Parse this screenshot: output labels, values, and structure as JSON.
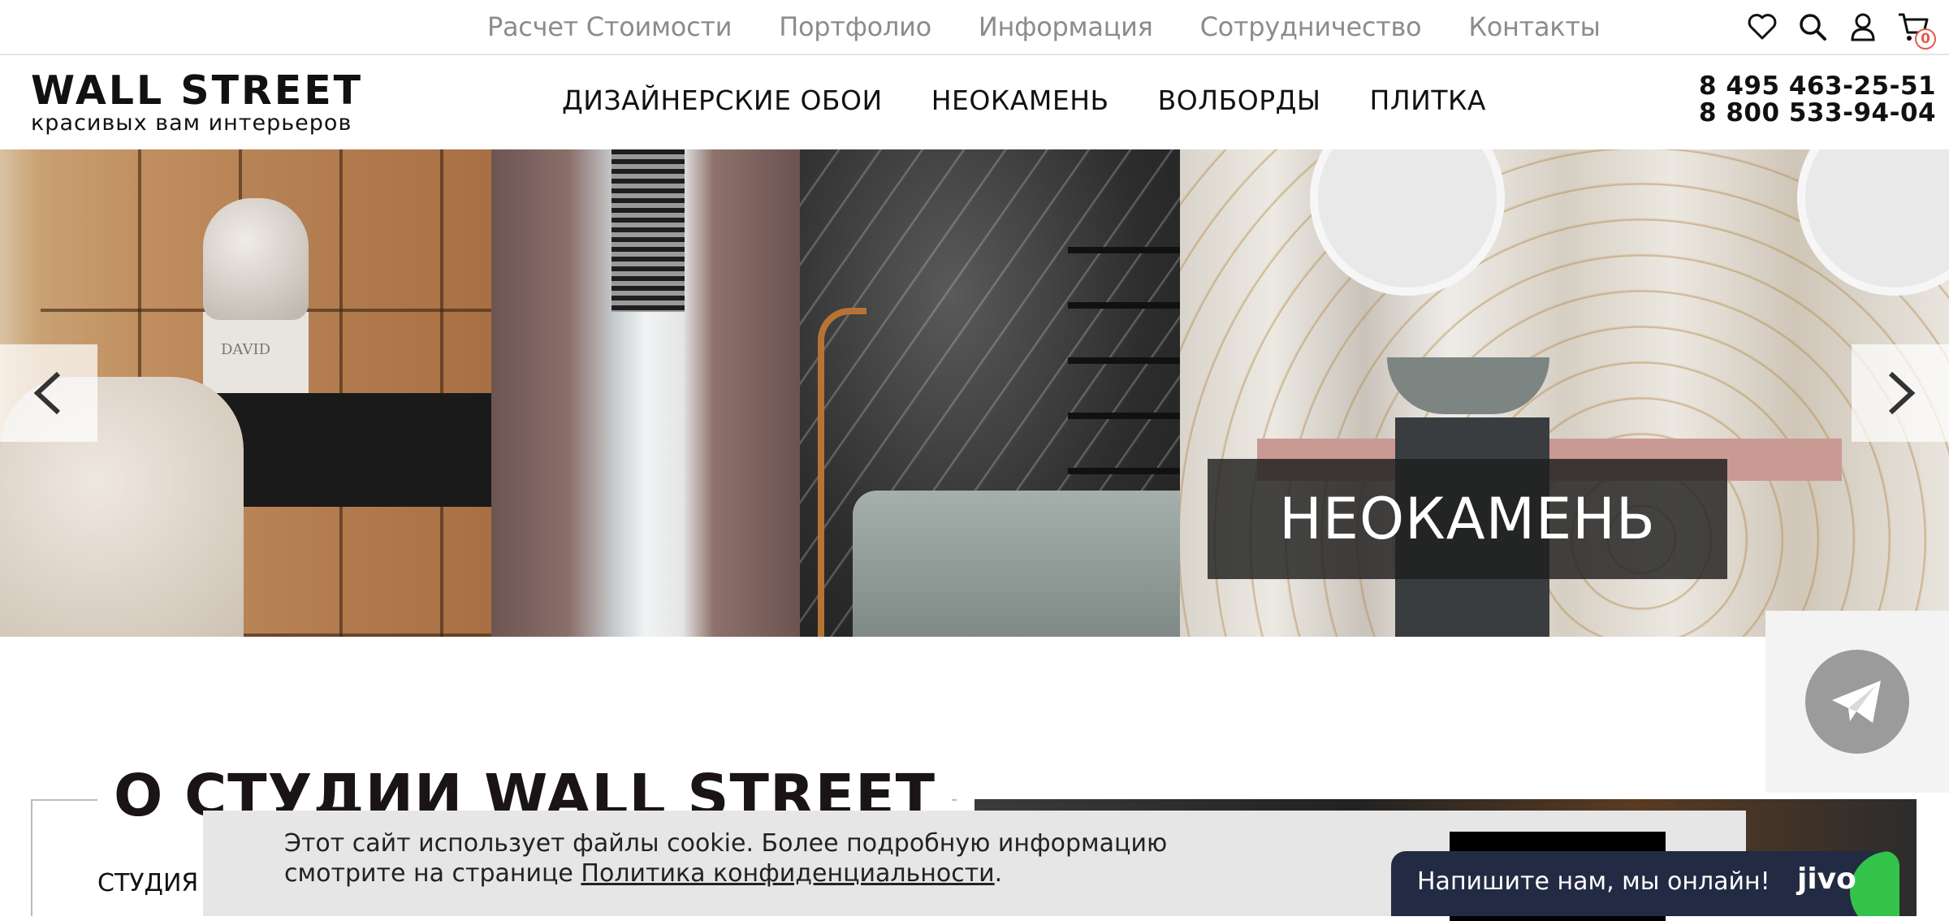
{
  "top_nav": [
    "Расчет Стоимости",
    "Портфолио",
    "Информация",
    "Сотрудничество",
    "Контакты"
  ],
  "cart_count": "0",
  "logo": {
    "title": "WALL STREET",
    "subtitle": "красивых вам интерьеров"
  },
  "main_nav": [
    "ДИЗАЙНЕРСКИЕ ОБОИ",
    "НЕОКАМЕНЬ",
    "ВОЛБОРДЫ",
    "ПЛИТКА"
  ],
  "phones": [
    "8 495 463-25-51",
    "8 800 533-94-04"
  ],
  "slider": {
    "caption": "НЕОКАМЕНЬ",
    "bust_text": "DAVID"
  },
  "about": {
    "title": "О СТУДИИ WALL STREET",
    "text": "СТУДИЯ"
  },
  "cookie": {
    "text": "Этот сайт использует файлы cookie. Более подробную информацию смотрите на странице ",
    "link": "Политика конфиденциальности",
    "end": "."
  },
  "jivo": {
    "text": "Напишите нам, мы онлайн!",
    "logo": "jivo"
  },
  "colors": {
    "accent": "#e55a4a",
    "chat_bg": "#232a43",
    "chat_green": "#34c34a",
    "cookie_bg": "#e6e6e6"
  },
  "icons": [
    "heart-icon",
    "search-icon",
    "user-icon",
    "cart-icon",
    "chevron-left-icon",
    "chevron-right-icon",
    "telegram-icon"
  ]
}
